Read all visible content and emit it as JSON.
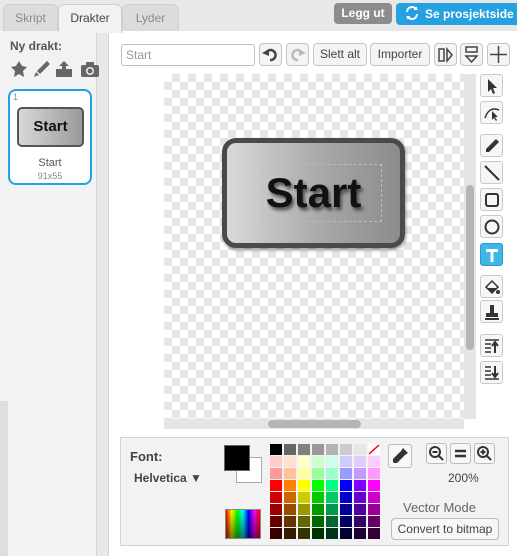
{
  "tabs": [
    {
      "label": "Skript",
      "active": false
    },
    {
      "label": "Drakter",
      "active": true
    },
    {
      "label": "Lyder",
      "active": false
    }
  ],
  "header": {
    "logout_label": "Legg ut",
    "project_label": "Se prosjektside",
    "accent_color": "#25a0e0"
  },
  "sidebar": {
    "new_costume_label": "Ny drakt:",
    "new_costume_tools": [
      "sprite-library-icon",
      "paint-brush-icon",
      "upload-icon",
      "camera-icon"
    ],
    "costumes": [
      {
        "number": "1",
        "thumb_text": "Start",
        "name": "Start",
        "size": "91x55"
      }
    ]
  },
  "toolbar": {
    "name_value": "Start",
    "undo_icon": "undo-icon",
    "redo_icon": "redo-icon",
    "clear_label": "Slett alt",
    "import_label": "Importer",
    "flip_h_icon": "flip-horizontal-icon",
    "flip_v_icon": "flip-vertical-icon",
    "center_icon": "crosshair-icon"
  },
  "canvas": {
    "button_text": "Start"
  },
  "tools": [
    {
      "name": "select-tool",
      "icon": "arrow-icon",
      "active": false
    },
    {
      "name": "reshape-tool",
      "icon": "reshape-icon",
      "active": false
    },
    {
      "name": "pencil-tool",
      "icon": "pencil-icon",
      "active": false
    },
    {
      "name": "line-tool",
      "icon": "line-icon",
      "active": false
    },
    {
      "name": "rectangle-tool",
      "icon": "rectangle-icon",
      "active": false
    },
    {
      "name": "ellipse-tool",
      "icon": "ellipse-icon",
      "active": false
    },
    {
      "name": "text-tool",
      "icon": "text-icon",
      "active": true
    },
    {
      "name": "fill-tool",
      "icon": "bucket-icon",
      "active": false
    },
    {
      "name": "stamp-tool",
      "icon": "stamp-icon",
      "active": false
    },
    {
      "name": "forward-layer-tool",
      "icon": "bring-forward-icon",
      "active": false
    },
    {
      "name": "backward-layer-tool",
      "icon": "send-backward-icon",
      "active": false
    }
  ],
  "props": {
    "font_label": "Font:",
    "font_value": "Helvetica",
    "primary_color": "#000000",
    "secondary_color": "#ffffff",
    "zoom_level": "200%",
    "mode_label": "Vector Mode",
    "convert_label": "Convert to bitmap"
  },
  "palette": [
    [
      "#000000",
      "#666666",
      "#808080",
      "#999999",
      "#b3b3b3",
      "#cccccc",
      "#e6e6e6",
      "none"
    ],
    [
      "#ffcccc",
      "#ffe0cc",
      "#ffffcc",
      "#ccffcc",
      "#ccffe6",
      "#ccccff",
      "#e0ccff",
      "#ffccff"
    ],
    [
      "#ff9999",
      "#ffc299",
      "#ffff99",
      "#99ff99",
      "#99ffcc",
      "#9999ff",
      "#c299ff",
      "#ff99ff"
    ],
    [
      "#ff0000",
      "#ff8000",
      "#ffff00",
      "#00ff00",
      "#00ff80",
      "#0000ff",
      "#8000ff",
      "#ff00ff"
    ],
    [
      "#cc0000",
      "#cc6600",
      "#cccc00",
      "#00cc00",
      "#00cc66",
      "#0000cc",
      "#6600cc",
      "#cc00cc"
    ],
    [
      "#990000",
      "#994c00",
      "#999900",
      "#009900",
      "#00994c",
      "#000099",
      "#4c0099",
      "#990099"
    ],
    [
      "#660000",
      "#663300",
      "#666600",
      "#006600",
      "#006633",
      "#000066",
      "#330066",
      "#660066"
    ],
    [
      "#330000",
      "#331a00",
      "#333300",
      "#003300",
      "#00331a",
      "#000033",
      "#1a0033",
      "#330033"
    ]
  ]
}
